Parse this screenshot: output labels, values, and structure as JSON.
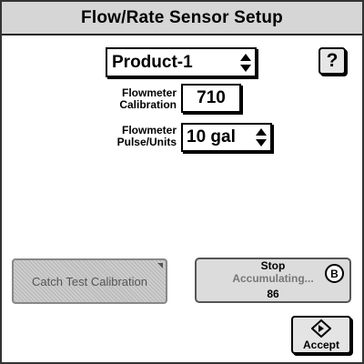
{
  "title": "Flow/Rate Sensor Setup",
  "product_select": {
    "value": "Product-1",
    "icon": "spinner-arrows-icon"
  },
  "help_button": {
    "label": "?"
  },
  "flowmeter_calibration": {
    "label_line1": "Flowmeter",
    "label_line2": "Calibration",
    "value": "710"
  },
  "flowmeter_pulse": {
    "label_line1": "Flowmeter",
    "label_line2": "Pulse/Units",
    "value": "10 gal",
    "icon": "spinner-arrows-icon"
  },
  "catch_test_button": {
    "label": "Catch Test Calibration",
    "state": "disabled"
  },
  "stop_button": {
    "line1": "Stop",
    "line2": "Accumulating...",
    "count": "86",
    "badge": "B"
  },
  "accept_button": {
    "label": "Accept",
    "icon": "accept-diamond-icon"
  },
  "colors": {
    "title_bar": "#d6d6d6",
    "button_bg": "#dcdcdc",
    "disabled_bg": "#bdbdbd",
    "border": "#000000"
  }
}
